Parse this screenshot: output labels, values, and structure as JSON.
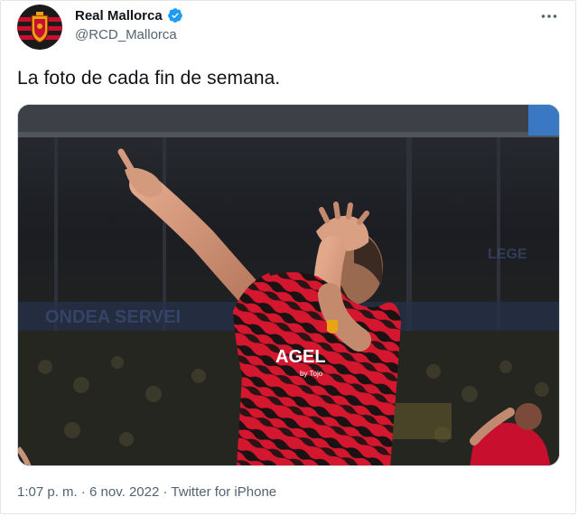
{
  "tweet": {
    "author_name": "Real Mallorca",
    "author_handle": "@RCD_Mallorca",
    "text": "La foto de cada fin de semana.",
    "time": "1:07 p. m.",
    "separator": "·",
    "date": "6 nov. 2022",
    "source": "Twitter for iPhone"
  },
  "media": {
    "jersey_sponsor": "AGEL",
    "jersey_sponsor_sub": "by Tojo"
  },
  "icons": {
    "avatar": "club-crest-icon",
    "verified": "verified-badge-icon",
    "more": "more-options-icon"
  },
  "colors": {
    "verified": "#1d9bf0",
    "jersey_red": "#c8102e",
    "muted_text": "#536471"
  }
}
